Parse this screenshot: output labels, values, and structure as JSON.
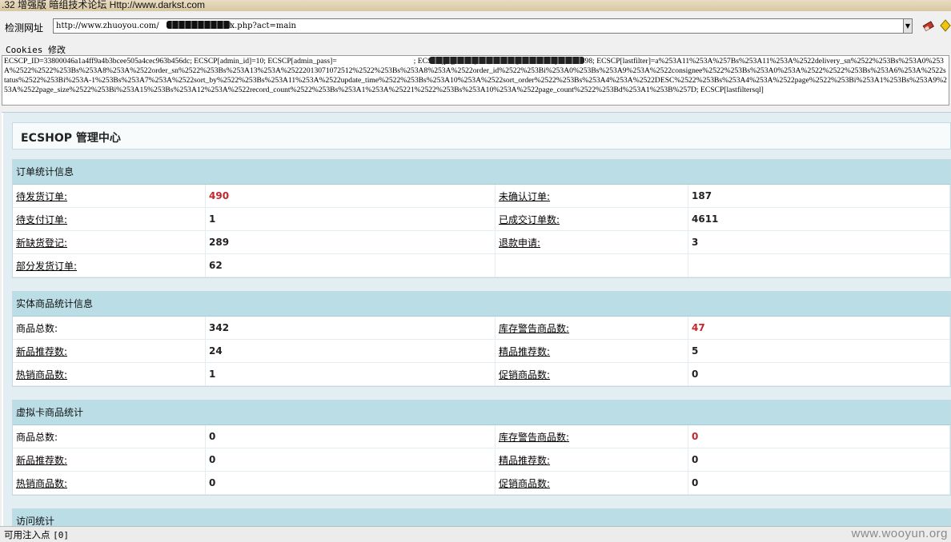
{
  "window": {
    "title": ".32 增强版 暗组技术论坛 Http://www.darkst.com"
  },
  "url_bar": {
    "label": "检测网址",
    "value": "http://www.zhuoyou.com/                    /index.php?act=main"
  },
  "cookies": {
    "label": "Cookies 修改",
    "value": "ECSCP_ID=33800046a1a4ff9a4b3bcee505a4cec963b456dc; ECSCP[admin_id]=10; ECSCP[admin_pass]=                                        ; ECSCP[page_size]=15; ECSCP[lastfilterfile]=F5299398; ECSCP[lastfilter]=a%253A11%253A%257Bs%253A11%253A%2522delivery_sn%2522%253Bs%253A0%253A%2522%2522%253Bs%253A8%253A%2522order_sn%2522%253Bs%253A13%253A%252220130710725​12%2522%253Bs%253A8%253A%2522order_id%2522%253Bi%253A0%253Bs%253A9%253A%2522consignee%2522%253Bs%253A0%253A%2522%2522%253Bs%253A6%253A%2522status%2522%253Bi%253A-1%253Bs%253A7%253A%2522sort_by%2522%253Bs%253A11%253A%2522update_time%2522%253Bs%253A10%253A%2522sort_order%2522%253Bs%253A4%253A%2522DESC%2522%253Bs%253A4%253A%2522page%2522%253Bi%253A1%253Bs%253A9%253A%2522page_size%2522%253Bi%253A15%253Bs%253A12%253A%2522record_count%2522%253Bs%253A1%253A%25221%2522%253Bs%253A10%253A%2522page_count%2522%253Bd%253A1%253B%257D; ECSCP[lastfiltersql]"
  },
  "page": {
    "title": "ECSHOP 管理中心",
    "sections": [
      {
        "heading": "订单统计信息",
        "rows": [
          [
            {
              "label": "待发货订单:",
              "link": true
            },
            {
              "value": "490",
              "red": true
            },
            {
              "label": "未确认订单:",
              "link": true
            },
            {
              "value": "187",
              "red": false
            }
          ],
          [
            {
              "label": "待支付订单:",
              "link": true
            },
            {
              "value": "1",
              "red": false
            },
            {
              "label": "已成交订单数:",
              "link": true
            },
            {
              "value": "4611",
              "red": false
            }
          ],
          [
            {
              "label": "新缺货登记:",
              "link": true
            },
            {
              "value": "289",
              "red": false
            },
            {
              "label": "退款申请:",
              "link": true
            },
            {
              "value": "3",
              "red": false
            }
          ],
          [
            {
              "label": "部分发货订单:",
              "link": true
            },
            {
              "value": "62",
              "red": false
            },
            {
              "label": "",
              "link": false
            },
            {
              "value": "",
              "red": false
            }
          ]
        ]
      },
      {
        "heading": "实体商品统计信息",
        "rows": [
          [
            {
              "label": "商品总数:",
              "link": false
            },
            {
              "value": "342",
              "red": false
            },
            {
              "label": "库存警告商品数:",
              "link": true
            },
            {
              "value": "47",
              "red": true
            }
          ],
          [
            {
              "label": "新品推荐数:",
              "link": true
            },
            {
              "value": "24",
              "red": false
            },
            {
              "label": "精品推荐数:",
              "link": true
            },
            {
              "value": "5",
              "red": false
            }
          ],
          [
            {
              "label": "热销商品数:",
              "link": true
            },
            {
              "value": "1",
              "red": false
            },
            {
              "label": "促销商品数:",
              "link": true
            },
            {
              "value": "0",
              "red": false
            }
          ]
        ]
      },
      {
        "heading": "虚拟卡商品统计",
        "rows": [
          [
            {
              "label": "商品总数:",
              "link": false
            },
            {
              "value": "0",
              "red": false
            },
            {
              "label": "库存警告商品数:",
              "link": true
            },
            {
              "value": "0",
              "red": true
            }
          ],
          [
            {
              "label": "新品推荐数:",
              "link": true
            },
            {
              "value": "0",
              "red": false
            },
            {
              "label": "精品推荐数:",
              "link": true
            },
            {
              "value": "0",
              "red": false
            }
          ],
          [
            {
              "label": "热销商品数:",
              "link": true
            },
            {
              "value": "0",
              "red": false
            },
            {
              "label": "促销商品数:",
              "link": true
            },
            {
              "value": "0",
              "red": false
            }
          ]
        ]
      },
      {
        "heading": "访问统计",
        "rows": []
      }
    ]
  },
  "status_bar": {
    "label": "可用注入点",
    "count": "[0]"
  },
  "watermark": "www.wooyun.org",
  "colors": {
    "section_header_bg": "#bbdde6",
    "alert_value": "#c1272d",
    "page_bg": "#e3eef3"
  }
}
